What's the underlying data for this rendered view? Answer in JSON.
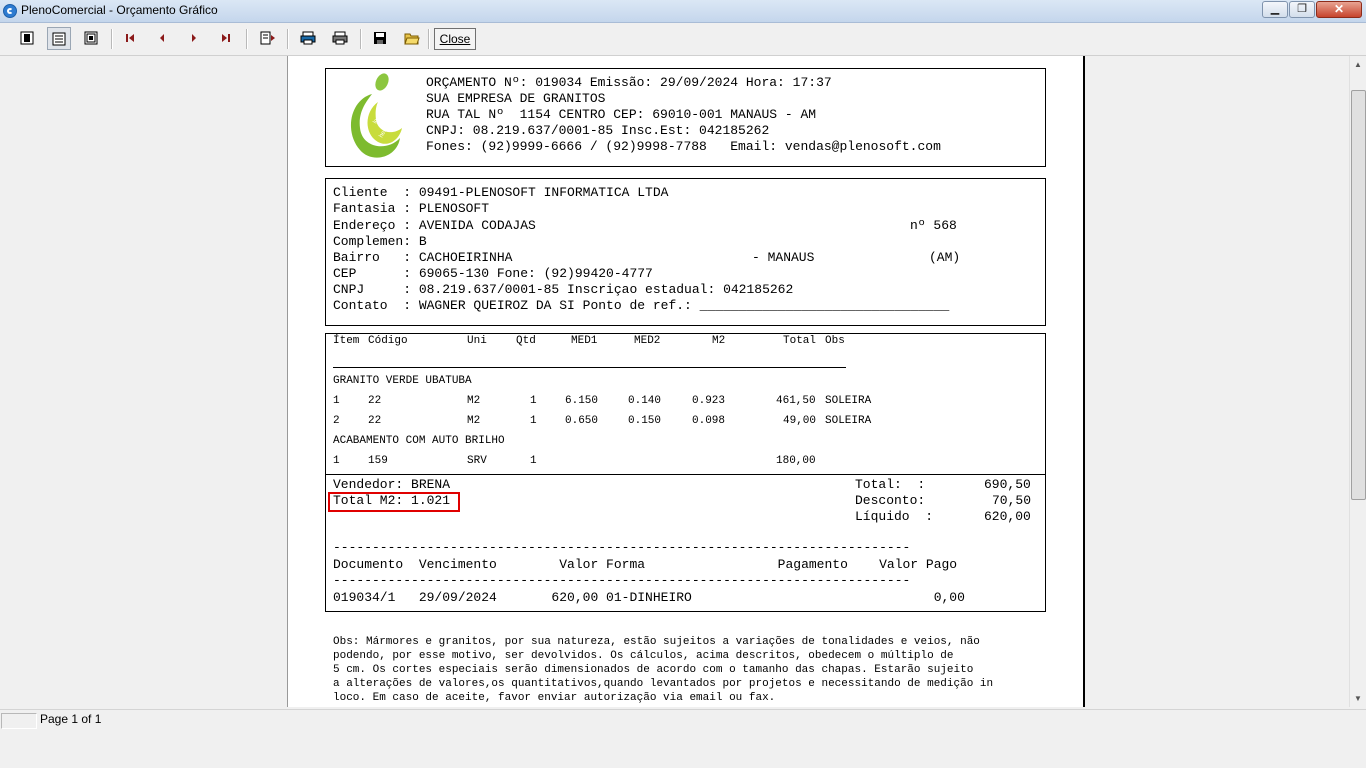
{
  "window": {
    "title": "PlenoComercial - Orçamento Gráfico",
    "close_label": "Close"
  },
  "status": {
    "page_text": "Page 1 of 1"
  },
  "header": {
    "logo_text": "logo here",
    "line1": "ORÇAMENTO Nº: 019034 Emissão: 29/09/2024 Hora: 17:37",
    "line2": "SUA EMPRESA DE GRANITOS",
    "line3": "RUA TAL Nº  1154 CENTRO CEP: 69010-001 MANAUS - AM",
    "line4": "CNPJ: 08.219.637/0001-85 Insc.Est: 042185262",
    "line5": "Fones: (92)9999-6666 / (92)9998-7788   Email: vendas@plenosoft.com"
  },
  "client": {
    "cliente": "Cliente  : 09491-PLENOSOFT INFORMATICA LTDA",
    "fantasia": "Fantasia : PLENOSOFT",
    "endereco": "Endereço : AVENIDA CODAJAS",
    "numero": "nº 568",
    "complemento": "Complemen: B",
    "bairro": "Bairro   : CACHOEIRINHA",
    "cidade": "- MANAUS",
    "uf": "(AM)",
    "cep": "CEP      : 69065-130 Fone: (92)99420-4777",
    "cnpj": "CNPJ     : 08.219.637/0001-85 Inscriçao estadual: 042185262",
    "contato": "Contato  : WAGNER QUEIROZ DA SI Ponto de ref.: ________________________________"
  },
  "items": {
    "headers": {
      "item": "Ítem",
      "codigo": "Código",
      "uni": "Uni",
      "qtd": "Qtd",
      "med1": "MED1",
      "med2": "MED2",
      "m2": "M2",
      "total": "Total",
      "obs": "Obs"
    },
    "group1": "GRANITO VERDE UBATUBA",
    "rows1": [
      {
        "item": "1",
        "codigo": "22",
        "uni": "M2",
        "qtd": "1",
        "med1": "6.150",
        "med2": "0.140",
        "m2": "0.923",
        "total": "461,50",
        "obs": "SOLEIRA"
      },
      {
        "item": "2",
        "codigo": "22",
        "uni": "M2",
        "qtd": "1",
        "med1": "0.650",
        "med2": "0.150",
        "m2": "0.098",
        "total": "49,00",
        "obs": "SOLEIRA"
      }
    ],
    "group2": "ACABAMENTO COM AUTO BRILHO",
    "rows2": [
      {
        "item": "1",
        "codigo": "159",
        "uni": "SRV",
        "qtd": "1",
        "med1": "",
        "med2": "",
        "m2": "",
        "total": "180,00",
        "obs": ""
      }
    ]
  },
  "totals": {
    "vendedor": "Vendedor: BRENA",
    "total_m2": "Total M2: 1.021",
    "total_label": "Total:  :",
    "total_value": "690,50",
    "desconto_label": "Desconto:",
    "desconto_value": "70,50",
    "liquido_label": "Líquido  :",
    "liquido_value": "620,00"
  },
  "payments": {
    "dashes": "--------------------------------------------------------------------------",
    "header": "Documento  Vencimento        Valor Forma                 Pagamento    Valor Pago",
    "row": "019034/1   29/09/2024       620,00 01-DINHEIRO                               0,00"
  },
  "obs": {
    "line1": "Obs: Mármores e granitos, por sua natureza, estão sujeitos a variações de tonalidades e veios, não",
    "line2": "podendo, por esse motivo, ser devolvidos. Os cálculos, acima descritos, obedecem o múltiplo de",
    "line3": "5 cm. Os cortes especiais serão dimensionados de acordo com o tamanho das chapas. Estarão sujeito",
    "line4": "a alterações de valores,os quantitativos,quando levantados por projetos e necessitando de medição in",
    "line5": "loco. Em caso de aceite, favor enviar autorização via email ou fax."
  },
  "colors": {
    "highlight": "#e00000",
    "logo_green": "#8cc63f"
  }
}
